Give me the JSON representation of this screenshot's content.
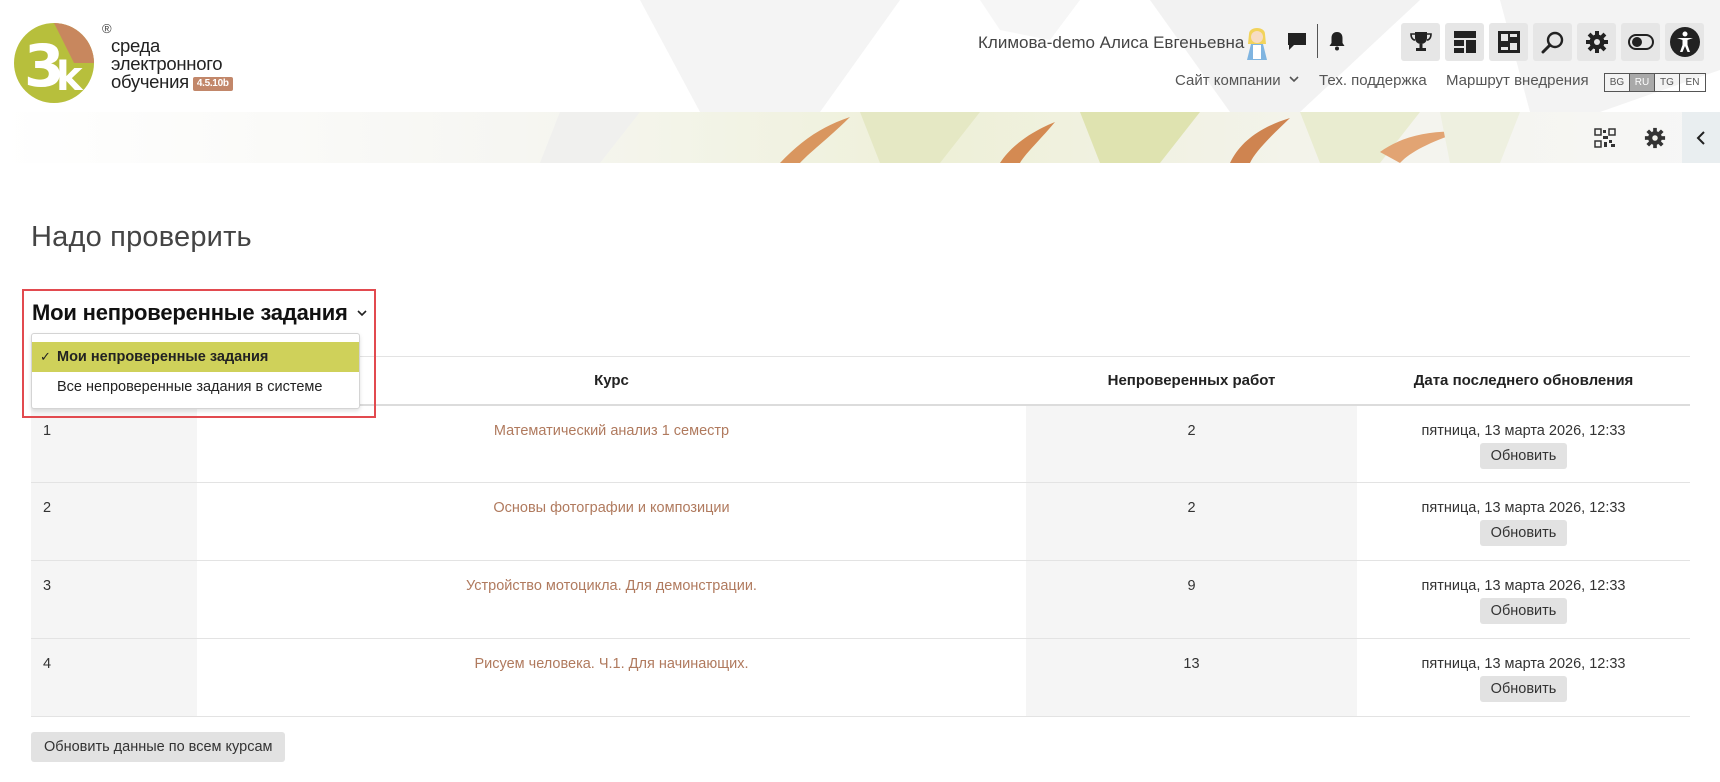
{
  "header": {
    "logo": {
      "mark": "3k",
      "line1": "среда",
      "line2": "электронного",
      "line3": "обучения",
      "registered": "®",
      "version": "4.5.10b"
    },
    "user_name": "Климова-demo Алиса Евгеньевна",
    "nav": {
      "company_site": "Сайт компании",
      "support": "Тех. поддержка",
      "roadmap": "Маршрут внедрения"
    },
    "languages": [
      "BG",
      "RU",
      "TG",
      "EN"
    ],
    "active_language": "RU"
  },
  "main": {
    "title": "Надо проверить",
    "filter": {
      "selected": "Мои непроверенные задания",
      "options": [
        "Мои непроверенные задания",
        "Все непроверенные задания в системе"
      ],
      "check_mark": "✓"
    },
    "table": {
      "headers": [
        "",
        "Курс",
        "Непроверенных работ",
        "Дата последнего обновления"
      ],
      "rows": [
        {
          "num": "1",
          "course": "Математический анализ 1 семестр",
          "count": "2",
          "date": "пятница, 13 марта 2026, 12:33",
          "button": "Обновить"
        },
        {
          "num": "2",
          "course": "Основы фотографии и композиции",
          "count": "2",
          "date": "пятница, 13 марта 2026, 12:33",
          "button": "Обновить"
        },
        {
          "num": "3",
          "course": "Устройство мотоцикла. Для демонстрации.",
          "count": "9",
          "date": "пятница, 13 марта 2026, 12:33",
          "button": "Обновить"
        },
        {
          "num": "4",
          "course": "Рисуем человека. Ч.1. Для начинающих.",
          "count": "13",
          "date": "пятница, 13 марта 2026, 12:33",
          "button": "Обновить"
        }
      ]
    },
    "refresh_all": "Обновить данные по всем курсам"
  },
  "colors": {
    "accent_yellow": "#cfd15a",
    "link": "#b07a5e",
    "highlight_outline": "#e24a4f",
    "logo_green": "#b7bf3c"
  }
}
